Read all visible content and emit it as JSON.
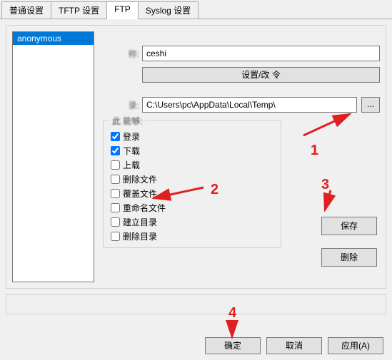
{
  "tabs": {
    "general": "普通设置",
    "tftp": "TFTP 设置",
    "ftp": "FTP",
    "syslog": "Syslog 设置"
  },
  "userlist": {
    "anonymous": "anonymous"
  },
  "fields": {
    "name_label": "称:",
    "name_value": "ceshi",
    "set_password_button": "设置/改          令",
    "dir_label": "录:",
    "dir_value": "C:\\Users\\pc\\AppData\\Local\\Temp\\",
    "browse_label": "..."
  },
  "permissions": {
    "group_title": "此       能够:",
    "items": [
      {
        "label": "登录",
        "checked": true
      },
      {
        "label": "下载",
        "checked": true
      },
      {
        "label": "上载",
        "checked": false
      },
      {
        "label": "删除文件",
        "checked": false
      },
      {
        "label": "覆盖文件",
        "checked": false
      },
      {
        "label": "重命名文件",
        "checked": false
      },
      {
        "label": "建立目录",
        "checked": false
      },
      {
        "label": "删除目录",
        "checked": false
      }
    ]
  },
  "side_buttons": {
    "save": "保存",
    "delete": "删除"
  },
  "bottom_buttons": {
    "ok": "确定",
    "cancel": "取消",
    "apply": "应用(A)"
  },
  "annotations": {
    "n1": "1",
    "n2": "2",
    "n3": "3",
    "n4": "4"
  }
}
